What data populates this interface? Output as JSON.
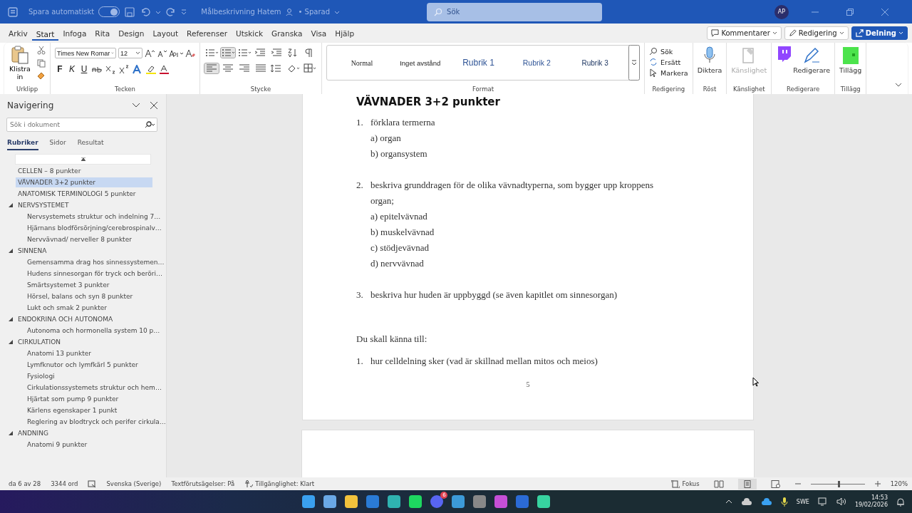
{
  "title_bar": {
    "autosave_label": "Spara automatiskt",
    "autosave_on": true,
    "document_title": "Målbeskrivning Hatem",
    "save_status": "• Sparad",
    "search_placeholder": "Sök",
    "avatar_initials": "AP"
  },
  "menu_tabs": [
    {
      "label": "Arkiv",
      "selected": false
    },
    {
      "label": "Start",
      "selected": true
    },
    {
      "label": "Infoga",
      "selected": false
    },
    {
      "label": "Rita",
      "selected": false
    },
    {
      "label": "Design",
      "selected": false
    },
    {
      "label": "Layout",
      "selected": false
    },
    {
      "label": "Referenser",
      "selected": false
    },
    {
      "label": "Utskick",
      "selected": false
    },
    {
      "label": "Granska",
      "selected": false
    },
    {
      "label": "Visa",
      "selected": false
    },
    {
      "label": "Hjälp",
      "selected": false
    }
  ],
  "menu_buttons": [
    {
      "label": "Kommentarer",
      "kind": "comment"
    },
    {
      "label": "Redigering",
      "kind": "edit"
    },
    {
      "label": "Delning",
      "kind": "share"
    }
  ],
  "ribbon": {
    "clipboard": {
      "paste_label": "Klistra in",
      "group_label": "Urklipp"
    },
    "font": {
      "font_name": "Times New Romar",
      "font_size": "12",
      "format_letters": [
        "F",
        "K",
        "U"
      ],
      "group_label": "Tecken"
    },
    "paragraph": {
      "group_label": "Stycke"
    },
    "styles": {
      "items": [
        {
          "label": "Normal",
          "kind": "normal"
        },
        {
          "label": "Inget avstånd",
          "kind": "no_spacing"
        },
        {
          "label": "Rubrik 1",
          "kind": "heading1"
        },
        {
          "label": "Rubrik 2",
          "kind": "heading2"
        },
        {
          "label": "Rubrik 3",
          "kind": "heading3"
        }
      ],
      "group_label": "Format"
    },
    "editing": {
      "items": [
        {
          "label": "Sök",
          "kind": "find"
        },
        {
          "label": "Ersätt",
          "kind": "replace"
        },
        {
          "label": "Markera",
          "kind": "select"
        }
      ],
      "group_label": "Redigering"
    },
    "voice": {
      "label": "Diktera",
      "group_label": "Röst"
    },
    "sensitivity": {
      "label": "Känslighet",
      "disabled": true,
      "group_label": "Känslighet"
    },
    "editor": {
      "label": "Redigerare",
      "group_label": "Redigerare"
    },
    "addins": {
      "label": "Tillägg",
      "group_label": "Tillägg"
    }
  },
  "navigation": {
    "title": "Navigering",
    "search_placeholder": "Sök i dokument",
    "tabs": [
      {
        "label": "Rubriker",
        "selected": true
      },
      {
        "label": "Sidor",
        "selected": false
      },
      {
        "label": "Resultat",
        "selected": false
      }
    ],
    "headings": [
      {
        "label": "CELLEN – 8 punkter",
        "selected": false
      },
      {
        "label": "VÄVNADER 3+2 punkter",
        "selected": true
      },
      {
        "label": "ANATOMISK TERMINOLOGI 5 punkter",
        "selected": false
      },
      {
        "label": "NERVSYSTEMET",
        "selected": false,
        "expanded": true,
        "children": [
          {
            "label": "Nervsystemets struktur och indelning 7…",
            "selected": false
          },
          {
            "label": "Hjärnans blodförsörjning/cerebrospinalv…",
            "selected": false
          },
          {
            "label": "Nervvävnad/ nerveller 8 punkter",
            "selected": false
          }
        ]
      },
      {
        "label": "SINNENA",
        "selected": false,
        "expanded": true,
        "children": [
          {
            "label": "Gemensamma drag hos sinnessystemen…",
            "selected": false
          },
          {
            "label": "Hudens sinnesorgan för tryck och berörі…",
            "selected": false
          },
          {
            "label": "Smärtsystemet 3 punkter",
            "selected": false
          },
          {
            "label": "Hörsel, balans och syn 8 punkter",
            "selected": false
          },
          {
            "label": "Lukt och smak 2 punkter",
            "selected": false
          }
        ]
      },
      {
        "label": "ENDOKRINA OCH AUTONOMA",
        "selected": false,
        "expanded": true,
        "children": [
          {
            "label": "Autonoma och hormonella system 10 p…",
            "selected": false
          }
        ]
      },
      {
        "label": "CIRKULATION",
        "selected": false,
        "expanded": true,
        "children": [
          {
            "label": "Anatomi 13 punkter",
            "selected": false
          },
          {
            "label": "Lymfknutor och lymfkärl 5 punkter",
            "selected": false
          },
          {
            "label": "Fysiologi",
            "selected": false
          },
          {
            "label": "Cirkulationssystemets struktur och hem…",
            "selected": false
          },
          {
            "label": "Hjärtat som pump 9 punkter",
            "selected": false
          },
          {
            "label": "Kärlens egenskaper 1 punkt",
            "selected": false
          },
          {
            "label": "Reglering av blodtryck och perifer cirkula…",
            "selected": false
          }
        ]
      },
      {
        "label": "ANDNING",
        "selected": false,
        "expanded": true,
        "children": [
          {
            "label": "Anatomi 9 punkter",
            "selected": false
          }
        ]
      }
    ]
  },
  "document": {
    "paragraphs": [
      {
        "kind": "heading",
        "text": "VÄVNADER 3+2 punkter"
      },
      {
        "kind": "numbered",
        "number": "1.",
        "text": "förklara termerna"
      },
      {
        "kind": "sub",
        "text": "a) organ"
      },
      {
        "kind": "sub",
        "text": "b) organsystem"
      },
      {
        "kind": "blank"
      },
      {
        "kind": "numbered",
        "number": "2.",
        "text": "beskriva grunddragen för de olika vävnadtyperna, som bygger upp kroppens organ;"
      },
      {
        "kind": "sub",
        "text": "a) epitelvävnad"
      },
      {
        "kind": "sub",
        "text": "b) muskelvävnad"
      },
      {
        "kind": "sub",
        "text": "c) stödjevävnad"
      },
      {
        "kind": "sub",
        "text": "d) nervvävnad"
      },
      {
        "kind": "blank"
      },
      {
        "kind": "numbered",
        "number": "3.",
        "text": "beskriva hur huden är uppbyggd (se även kapitlet om sinnesorgan)"
      },
      {
        "kind": "blank"
      },
      {
        "kind": "blank"
      },
      {
        "kind": "plain",
        "text": "Du skall känna till:"
      },
      {
        "kind": "numbered",
        "number": "1.",
        "text": "hur celldelning sker (vad är skillnad mellan mitos och meios)"
      }
    ],
    "page_number": "5"
  },
  "status_bar": {
    "page": "da 6 av 28",
    "words": "3344 ord",
    "language": "Svenska (Sverige)",
    "predictions": "Textförutsägelser: På",
    "accessibility": "Tillgänglighet: Klart",
    "focus": "Fokus",
    "zoom": {
      "level": 0.52
    },
    "zoom_percent": "120%"
  },
  "taskbar": {
    "badge": "6",
    "language": "SWE",
    "time": "14:53",
    "date": "19/02/2026"
  }
}
